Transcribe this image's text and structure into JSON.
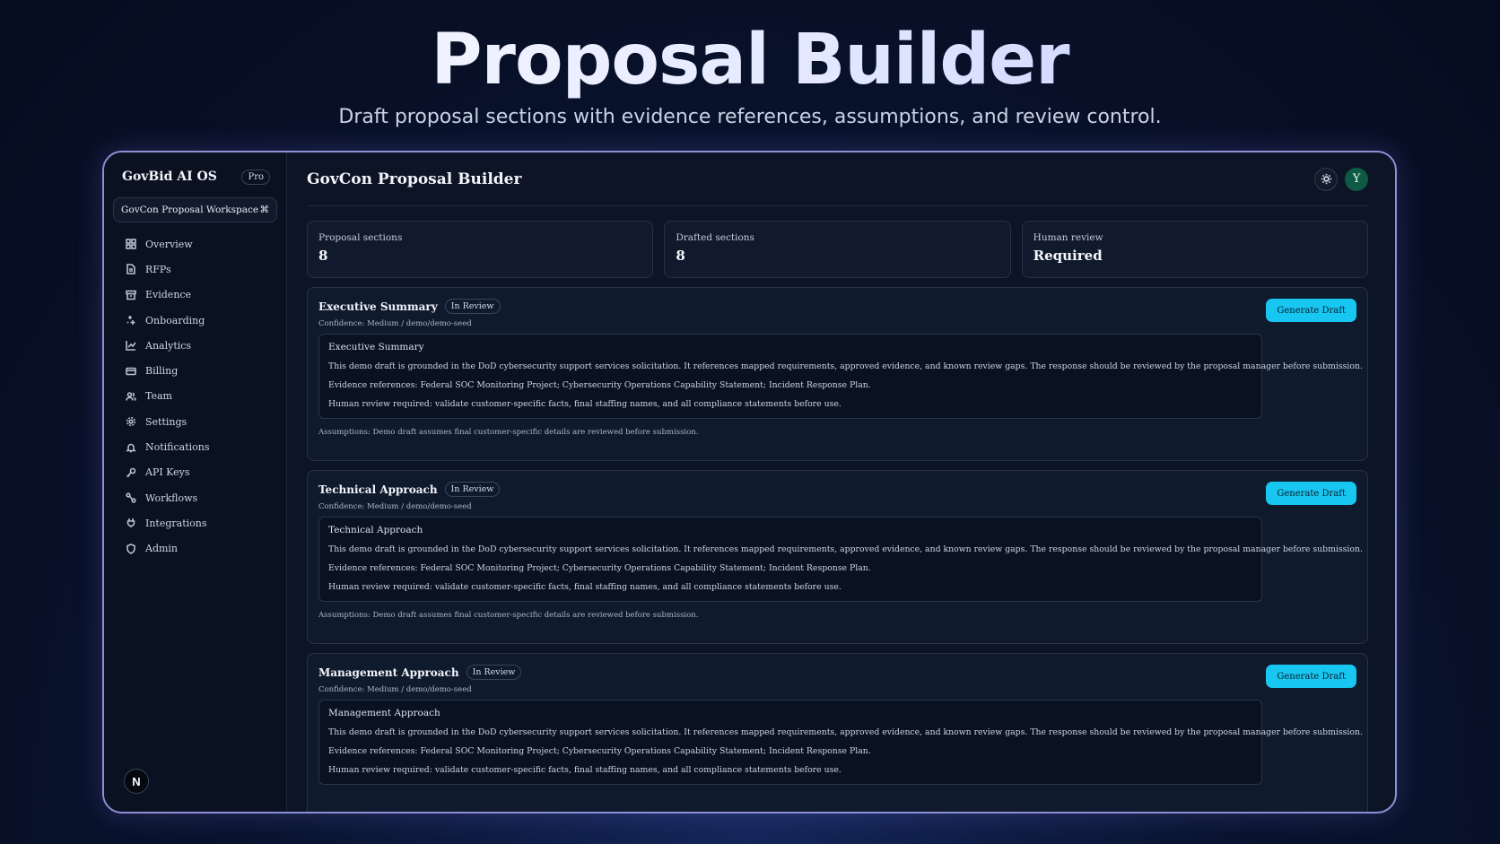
{
  "hero": {
    "title": "Proposal Builder",
    "subtitle": "Draft proposal sections with evidence references, assumptions, and review control."
  },
  "sidebar": {
    "brand": "GovBid AI OS",
    "plan_badge": "Pro",
    "workspace": "GovCon Proposal Workspace",
    "workspace_icon": "⌘",
    "items": [
      {
        "label": "Overview",
        "icon": "grid-icon"
      },
      {
        "label": "RFPs",
        "icon": "document-icon"
      },
      {
        "label": "Evidence",
        "icon": "archive-icon"
      },
      {
        "label": "Onboarding",
        "icon": "sparkles-icon"
      },
      {
        "label": "Analytics",
        "icon": "chart-icon"
      },
      {
        "label": "Billing",
        "icon": "credit-card-icon"
      },
      {
        "label": "Team",
        "icon": "users-icon"
      },
      {
        "label": "Settings",
        "icon": "gear-icon"
      },
      {
        "label": "Notifications",
        "icon": "bell-icon"
      },
      {
        "label": "API Keys",
        "icon": "key-icon"
      },
      {
        "label": "Workflows",
        "icon": "workflow-icon"
      },
      {
        "label": "Integrations",
        "icon": "plug-icon"
      },
      {
        "label": "Admin",
        "icon": "shield-icon"
      }
    ],
    "user_initial": "N"
  },
  "header": {
    "title": "GovCon Proposal Builder",
    "user_initial": "Y"
  },
  "stats": [
    {
      "label": "Proposal sections",
      "value": "8"
    },
    {
      "label": "Drafted sections",
      "value": "8"
    },
    {
      "label": "Human review",
      "value": "Required"
    }
  ],
  "sections": [
    {
      "title": "Executive Summary",
      "status": "In Review",
      "confidence": "Confidence: Medium / demo/demo-seed",
      "button": "Generate Draft",
      "draft_title": "Executive Summary",
      "body": "This demo draft is grounded in the DoD cybersecurity support services solicitation. It references mapped requirements, approved evidence, and known review gaps. The response should be reviewed by the proposal manager before submission.",
      "evidence": "Evidence references: Federal SOC Monitoring Project; Cybersecurity Operations Capability Statement; Incident Response Plan.",
      "review": "Human review required: validate customer-specific facts, final staffing names, and all compliance statements before use.",
      "assumptions": "Assumptions: Demo draft assumes final customer-specific details are reviewed before submission."
    },
    {
      "title": "Technical Approach",
      "status": "In Review",
      "confidence": "Confidence: Medium / demo/demo-seed",
      "button": "Generate Draft",
      "draft_title": "Technical Approach",
      "body": "This demo draft is grounded in the DoD cybersecurity support services solicitation. It references mapped requirements, approved evidence, and known review gaps. The response should be reviewed by the proposal manager before submission.",
      "evidence": "Evidence references: Federal SOC Monitoring Project; Cybersecurity Operations Capability Statement; Incident Response Plan.",
      "review": "Human review required: validate customer-specific facts, final staffing names, and all compliance statements before use.",
      "assumptions": "Assumptions: Demo draft assumes final customer-specific details are reviewed before submission."
    },
    {
      "title": "Management Approach",
      "status": "In Review",
      "confidence": "Confidence: Medium / demo/demo-seed",
      "button": "Generate Draft",
      "draft_title": "Management Approach",
      "body": "This demo draft is grounded in the DoD cybersecurity support services solicitation. It references mapped requirements, approved evidence, and known review gaps. The response should be reviewed by the proposal manager before submission.",
      "evidence": "Evidence references: Federal SOC Monitoring Project; Cybersecurity Operations Capability Statement; Incident Response Plan.",
      "review": "Human review required: validate customer-specific facts, final staffing names, and all compliance statements before use."
    }
  ],
  "colors": {
    "accent": "#18c6f2",
    "frame_border": "#8e8fd6",
    "avatar": "#0e5a44"
  }
}
